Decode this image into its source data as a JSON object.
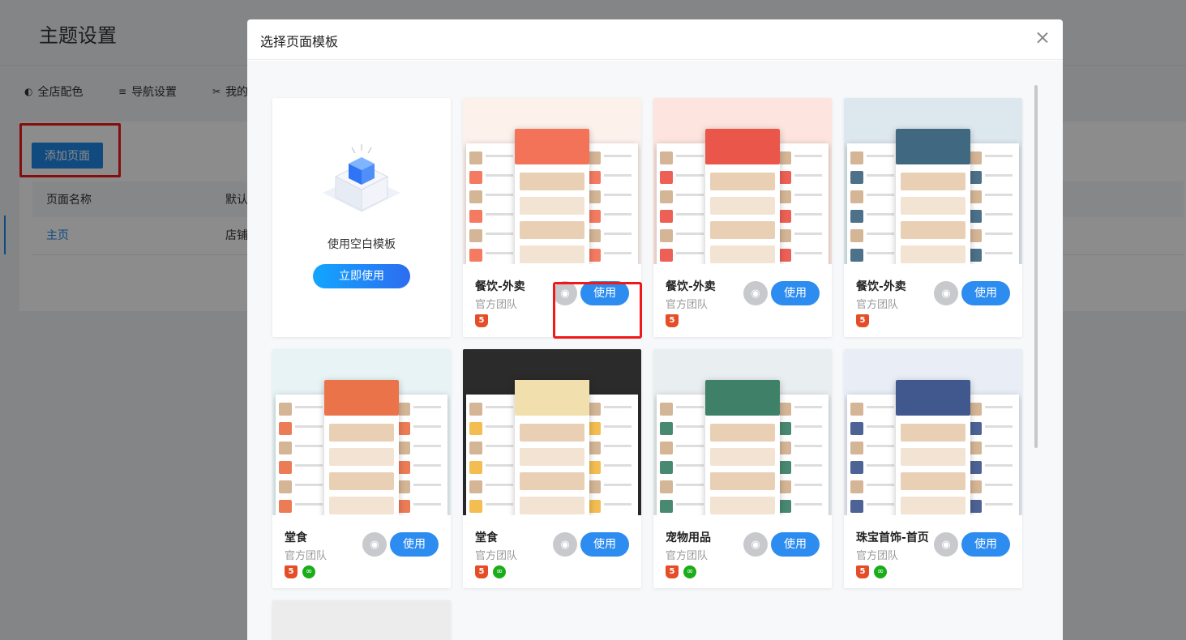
{
  "background_page": {
    "title": "主题设置",
    "tabs": [
      {
        "icon": "palette-icon",
        "label": "全店配色"
      },
      {
        "icon": "menu-icon",
        "label": "导航设置"
      },
      {
        "icon": "tools-icon",
        "label": "我的"
      }
    ],
    "add_page_button": "添加页面",
    "table_headers": [
      "页面名称",
      "默认"
    ],
    "rows": [
      {
        "name": "主页",
        "col2": "店铺"
      }
    ]
  },
  "modal": {
    "title": "选择页面模板",
    "blank_template": {
      "label": "使用空白模板",
      "button": "立即使用"
    },
    "templates": [
      {
        "name": "餐饮-外卖",
        "team": "官方团队",
        "badges": [
          "h5"
        ],
        "theme": "#fdf1ec",
        "accent": "#f15a3b"
      },
      {
        "name": "餐饮-外卖",
        "team": "官方团队",
        "badges": [
          "h5"
        ],
        "theme": "#fde4de",
        "accent": "#e8382a"
      },
      {
        "name": "餐饮-外卖",
        "team": "官方团队",
        "badges": [
          "h5"
        ],
        "theme": "#dde8ee",
        "accent": "#1f4e6b"
      },
      {
        "name": "堂食",
        "team": "官方团队",
        "badges": [
          "h5",
          "wx"
        ],
        "theme": "#e7f3f5",
        "accent": "#e75b2a"
      },
      {
        "name": "堂食",
        "team": "官方团队",
        "badges": [
          "h5",
          "wx"
        ],
        "theme": "#2b2b2b",
        "accent": "#f0ad27"
      },
      {
        "name": "宠物用品",
        "team": "官方团队",
        "badges": [
          "h5",
          "wx"
        ],
        "theme": "#e9eef0",
        "accent": "#1c6b4e"
      },
      {
        "name": "珠宝首饰-首页",
        "team": "官方团队",
        "badges": [
          "h5",
          "wx"
        ],
        "theme": "#e8edf6",
        "accent": "#203b7a"
      }
    ],
    "use_label": "使用",
    "preview_icon": "eye-icon",
    "close_icon": "close-icon"
  },
  "colors": {
    "primary": "#2d8cf0",
    "highlight": "#f01818"
  }
}
